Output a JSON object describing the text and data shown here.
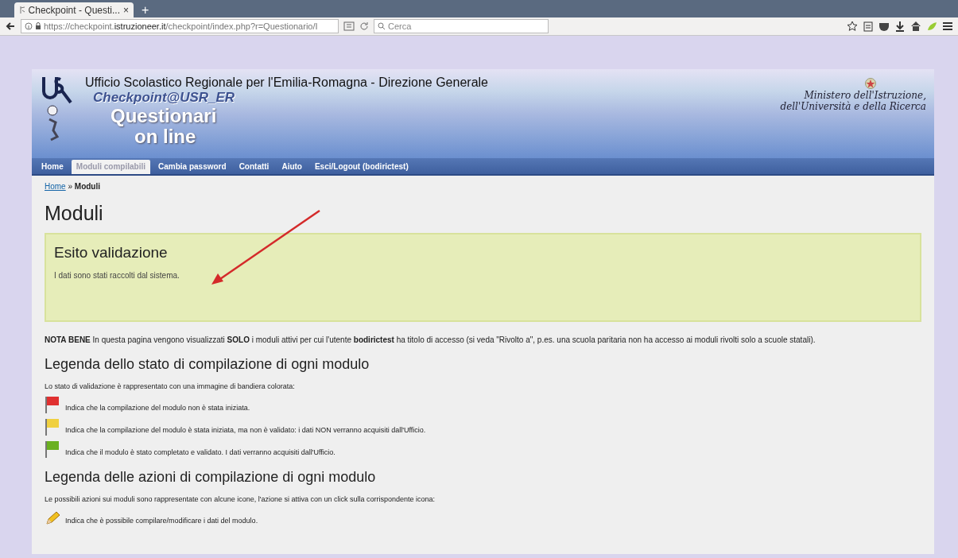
{
  "browser": {
    "tab_title": "Checkpoint - Questi...",
    "tab_close": "×",
    "new_tab": "+",
    "url": "https://checkpoint.**istruzioneer.it**/checkpoint/index.php?r=Questionario/I",
    "search_placeholder": "Cerca"
  },
  "header": {
    "office": "Ufficio Scolastico Regionale per l'Emilia-Romagna - Direzione Generale",
    "app_name": "Checkpoint@USR_ER",
    "title_line1": "Questionari",
    "title_line2": "on line",
    "ministry_line1": "Ministero dell'Istruzione,",
    "ministry_line2": "dell'Università e della Ricerca"
  },
  "nav": {
    "items": [
      {
        "label": "Home",
        "selected": false
      },
      {
        "label": "Moduli compilabili",
        "selected": true
      },
      {
        "label": "Cambia password",
        "selected": false
      },
      {
        "label": "Contatti",
        "selected": false
      },
      {
        "label": "Aiuto",
        "selected": false
      },
      {
        "label": "Esci/Logout (bodirictest)",
        "selected": false
      }
    ]
  },
  "breadcrumb": {
    "link": "Home",
    "separator": "»",
    "current": "Moduli"
  },
  "page_title": "Moduli",
  "notice": {
    "title": "Esito validazione",
    "message": "I dati sono stati raccolti dal sistema."
  },
  "note": "**NOTA BENE** In questa pagina vengono visualizzati **SOLO** i moduli attivi per cui l'utente **bodirictest** ha titolo di accesso (si veda \"Rivolto a\", p.es. una scuola paritaria non ha accesso ai moduli rivolti solo a scuole statali).",
  "status_legend": {
    "heading": "Legenda dello stato di compilazione di ogni modulo",
    "intro": "Lo stato di validazione è rappresentato con una immagine di bandiera colorata:",
    "items": [
      {
        "color": "#e03030",
        "text": "Indica che la compilazione del modulo non è stata iniziata."
      },
      {
        "color": "#f0d040",
        "text": "Indica che la compilazione del modulo è stata iniziata, ma non è validato: i dati NON verranno acquisiti dall'Ufficio."
      },
      {
        "color": "#6ab020",
        "text": "Indica che il modulo è stato completato e validato. I dati verranno acquisiti dall'Ufficio."
      }
    ]
  },
  "action_legend": {
    "heading": "Legenda delle azioni di compilazione di ogni modulo",
    "intro": "Le possibili azioni sui moduli sono rappresentate con alcune icone, l'azione si attiva con un click sulla corrispondente icona:",
    "items": [
      {
        "kind": "edit",
        "text": "Indica che è possibile compilare/modificare i dati del modulo."
      }
    ]
  }
}
